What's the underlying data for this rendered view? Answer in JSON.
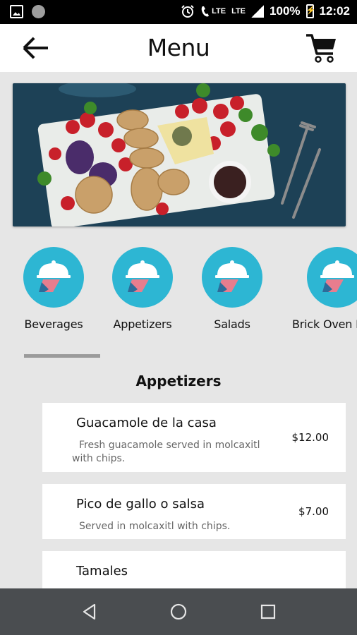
{
  "status_bar": {
    "battery_percent": "100%",
    "time": "12:02",
    "network_1": "LTE",
    "network_2": "LTE",
    "icons": [
      "image-icon",
      "circle-icon",
      "alarm-icon",
      "wifi-calling-icon",
      "signal-icon",
      "battery-charging-icon"
    ]
  },
  "app_bar": {
    "title": "Menu",
    "back_icon": "back-arrow-icon",
    "cart_icon": "cart-icon"
  },
  "categories": [
    {
      "label": "Beverages",
      "icon": "cloche-icon"
    },
    {
      "label": "Appetizers",
      "icon": "cloche-icon"
    },
    {
      "label": "Salads",
      "icon": "cloche-icon"
    },
    {
      "label": "Brick Oven P",
      "icon": "cloche-icon"
    }
  ],
  "section": {
    "title": "Appetizers"
  },
  "items": [
    {
      "name": "Guacamole de la casa",
      "desc_line1": "Fresh guacamole served in molcaxitl",
      "desc_line2": "with chips.",
      "price": "$12.00"
    },
    {
      "name": "Pico de gallo o salsa",
      "desc_line1": "Served in molcaxitl with chips.",
      "desc_line2": "",
      "price": "$7.00"
    },
    {
      "name": "Tamales",
      "desc_line1": "",
      "desc_line2": "",
      "price": ""
    }
  ],
  "colors": {
    "accent": "#2db6d3",
    "background": "#e6e6e6",
    "nav_bar": "#4a4d50"
  }
}
